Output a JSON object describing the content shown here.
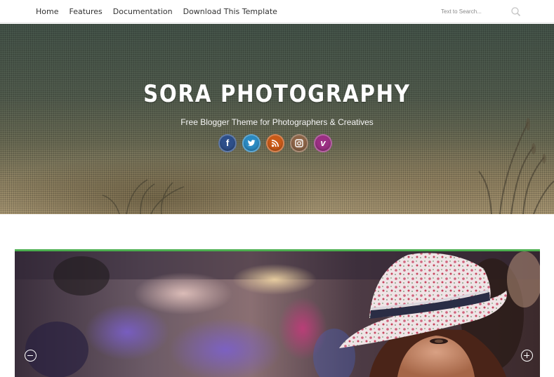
{
  "nav": {
    "items": [
      "Home",
      "Features",
      "Documentation",
      "Download This Template"
    ]
  },
  "search": {
    "placeholder": "Text to Search...",
    "icon": "search-icon"
  },
  "header": {
    "title": "SORA PHOTOGRAPHY",
    "description": "Free Blogger Theme for Photographers & Creatives",
    "social": [
      {
        "name": "facebook",
        "glyph": "f",
        "color": "#2d4f8a"
      },
      {
        "name": "twitter",
        "glyph": "t",
        "color": "#2b8ac2"
      },
      {
        "name": "rss",
        "glyph": "rss",
        "color": "#c95a18"
      },
      {
        "name": "instagram",
        "glyph": "cam",
        "color": "#8d6548"
      },
      {
        "name": "vimeo",
        "glyph": "v",
        "color": "#9b2f83"
      }
    ]
  },
  "slider": {
    "accent_color": "#4caf50",
    "prev_icon": "minus-circle-icon",
    "next_icon": "plus-circle-icon"
  }
}
